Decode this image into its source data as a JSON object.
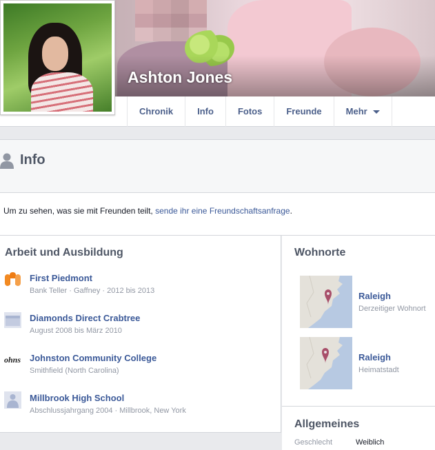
{
  "profile": {
    "name": "Ashton Jones"
  },
  "tabs": [
    {
      "label": "Chronik"
    },
    {
      "label": "Info"
    },
    {
      "label": "Fotos"
    },
    {
      "label": "Freunde"
    },
    {
      "label": "Mehr"
    }
  ],
  "info": {
    "title": "Info"
  },
  "notice": {
    "prefix": "Um zu sehen, was sie mit Freunden teilt, ",
    "link": "sende ihr eine Freundschaftsanfrage",
    "suffix": "."
  },
  "work": {
    "title": "Arbeit und Ausbildung",
    "items": [
      {
        "name": "First Piedmont",
        "sub": "Bank Teller · Gaffney · 2012 bis 2013",
        "icon": "first-piedmont-logo"
      },
      {
        "name": "Diamonds Direct Crabtree",
        "sub": "August 2008 bis März 2010",
        "icon": "briefcase-icon"
      },
      {
        "name": "Johnston Community College",
        "sub": "Smithfield (North Carolina)",
        "icon": "college-logo",
        "logo_text": "ohns"
      },
      {
        "name": "Millbrook High School",
        "sub": "Abschlussjahrgang 2004 · Millbrook, New York",
        "icon": "school-icon"
      }
    ]
  },
  "places": {
    "title": "Wohnorte",
    "items": [
      {
        "name": "Raleigh",
        "sub": "Derzeitiger Wohnort"
      },
      {
        "name": "Raleigh",
        "sub": "Heimatstadt"
      }
    ]
  },
  "general": {
    "title": "Allgemeines",
    "rows": [
      {
        "label": "Geschlecht",
        "value": "Weiblich"
      }
    ]
  },
  "colors": {
    "link": "#3b5998",
    "tab_text": "#4b5f8a",
    "muted": "#9197a3",
    "map_pin": "#b0506a"
  }
}
